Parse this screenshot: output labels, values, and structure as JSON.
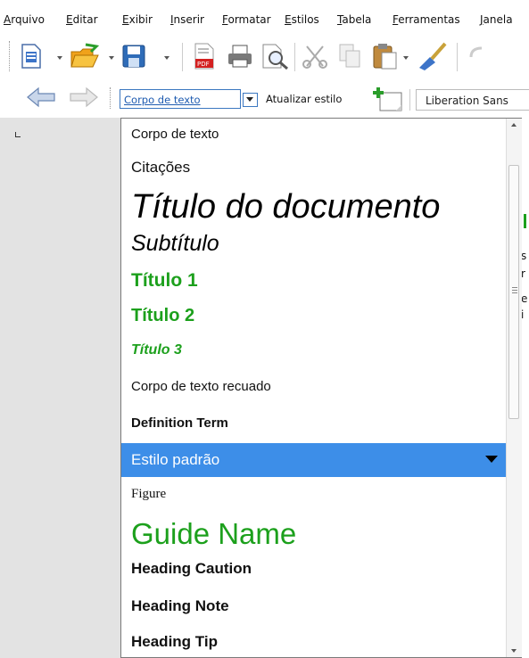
{
  "menu": [
    "Arquivo",
    "Editar",
    "Exibir",
    "Inserir",
    "Formatar",
    "Estilos",
    "Tabela",
    "Ferramentas",
    "Janela"
  ],
  "toolbar2": {
    "style_value": "Corpo de texto",
    "update_style_label": "Atualizar estilo",
    "font_name": "Liberation Sans"
  },
  "dropdown": {
    "items": [
      "Corpo de texto",
      "Citações",
      "Título do documento",
      "Subtítulo",
      "Título 1",
      "Título 2",
      "Título 3",
      "Corpo de texto recuado",
      "Definition Term",
      "Estilo padrão",
      "Figure",
      "Guide Name",
      "Heading Caution",
      "Heading Note",
      "Heading Tip"
    ],
    "selected_item": "Estilo padrão"
  },
  "right_edge_fragments": [
    "s",
    "r",
    "e",
    "i"
  ],
  "colors": {
    "heading_green": "#1ca01c",
    "selection_blue": "#3d8ee8",
    "combo_border": "#3b77c0"
  }
}
